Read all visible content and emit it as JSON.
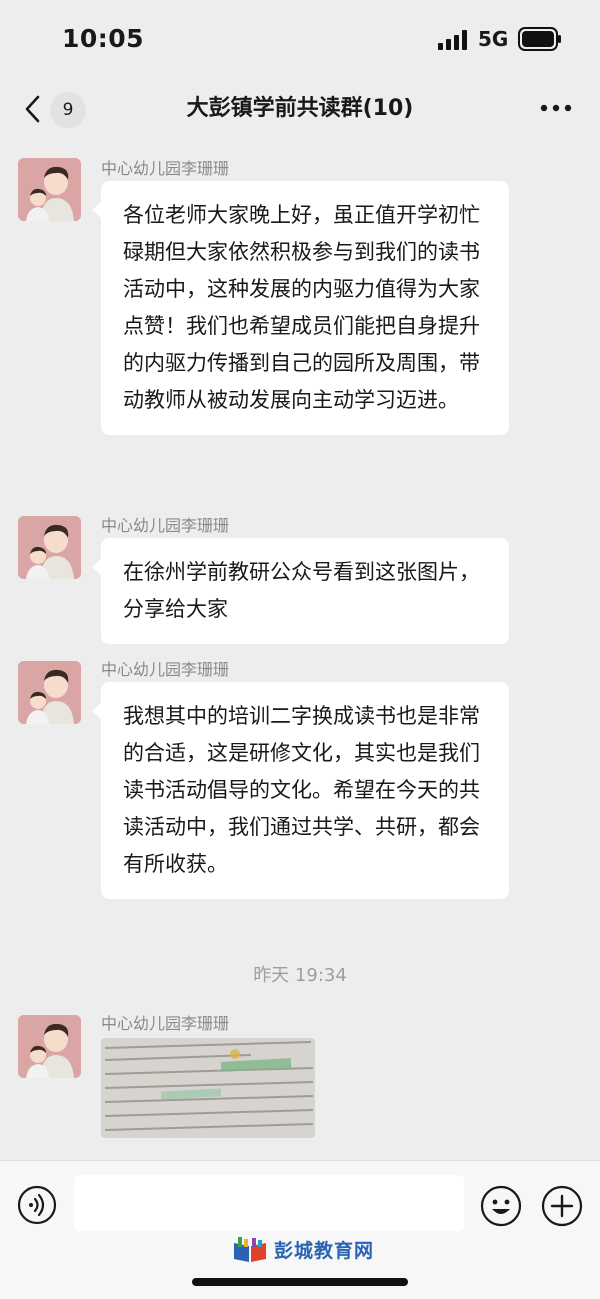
{
  "status_bar": {
    "time": "10:05",
    "network": "5G",
    "signal_icon": "cellular-signal-icon",
    "battery_icon": "battery-full-icon"
  },
  "nav": {
    "back_icon": "chevron-left-icon",
    "unread_count": "9",
    "title": "大彭镇学前共读群(10)",
    "more_icon": "more-horizontal-icon"
  },
  "messages": [
    {
      "sender": "中心幼儿园李珊珊",
      "text": "各位老师大家晚上好，虽正值开学初忙碌期但大家依然积极参与到我们的读书活动中，这种发展的内驱力值得为大家点赞！我们也希望成员们能把自身提升的内驱力传播到自己的园所及周围，带动教师从被动发展向主动学习迈进。"
    },
    {
      "sender": "中心幼儿园李珊珊",
      "text": "在徐州学前教研公众号看到这张图片，分享给大家"
    },
    {
      "sender": "中心幼儿园李珊珊",
      "text": "我想其中的培训二字换成读书也是非常的合适，这是研修文化，其实也是我们读书活动倡导的文化。希望在今天的共读活动中，我们通过共学、共研，都会有所收获。"
    },
    {
      "sender": "中心幼儿园李珊珊",
      "image_icon": "shared-photo-thumbnail"
    }
  ],
  "timestamp": "昨天 19:34",
  "input_bar": {
    "voice_icon": "voice-input-icon",
    "emoji_icon": "emoji-icon",
    "plus_icon": "plus-icon",
    "value": ""
  },
  "watermark": {
    "text": "彭城教育网"
  },
  "colors": {
    "background": "#ededed",
    "bubble": "#ffffff",
    "name_text": "#8a8a8a",
    "watermark": "#2a62b4"
  }
}
